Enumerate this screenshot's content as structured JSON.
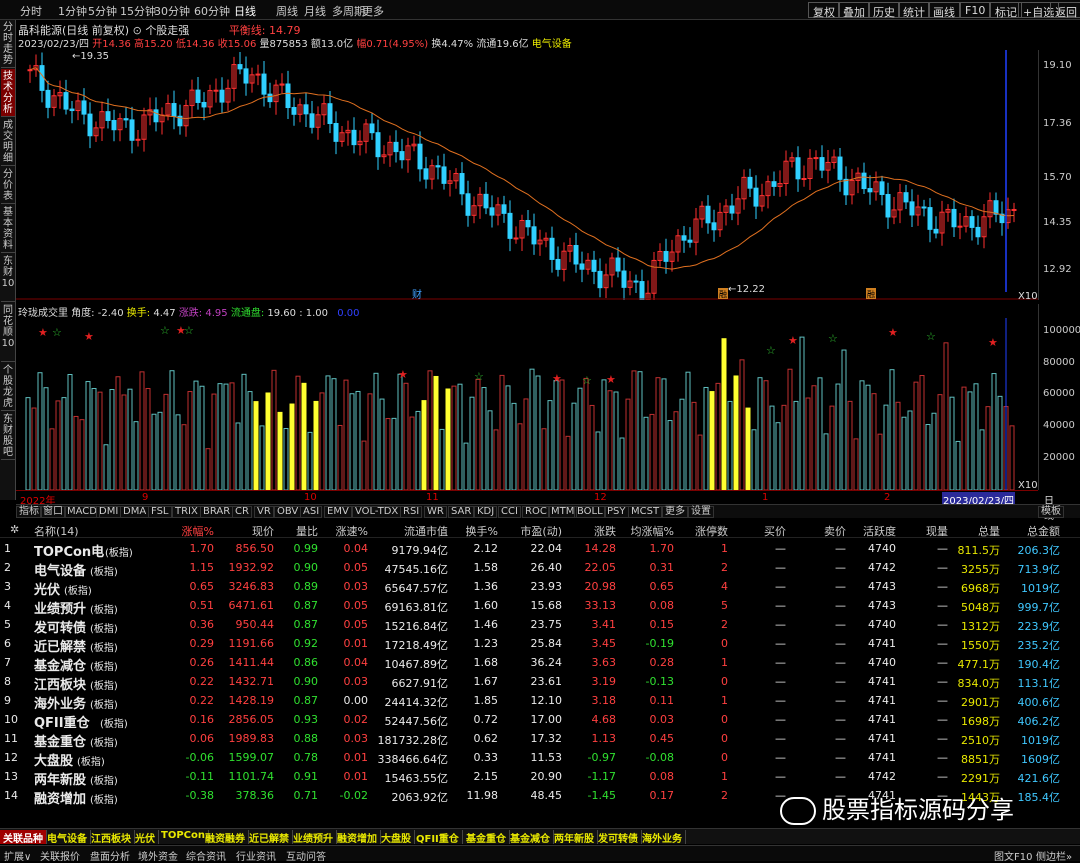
{
  "topbar": {
    "left_items": [
      "分时",
      "1分钟",
      "5分钟",
      "15分钟",
      "30分钟",
      "60分钟",
      "日线",
      "周线",
      "月线",
      "多周期",
      "更多"
    ],
    "active": "日线",
    "right_items": [
      "复权",
      "叠加",
      "历史",
      "统计",
      "画线",
      "F10",
      "标记",
      "+自选",
      "返回"
    ]
  },
  "left_tabs": [
    {
      "label": "分时走势",
      "active": false
    },
    {
      "label": "技术分析",
      "active": true
    },
    {
      "label": "成交明细",
      "active": false
    },
    {
      "label": "分价表",
      "active": false
    },
    {
      "label": "基本资料",
      "active": false
    },
    {
      "label": "东财10",
      "active": false
    },
    {
      "label": "同花顺10",
      "active": false
    },
    {
      "label": "个股龙虎",
      "active": false
    },
    {
      "label": "东财股吧",
      "active": false
    }
  ],
  "chart_header": {
    "title": "晶科能源(日线 前复权)",
    "mode": "个股走强",
    "balance_label": "平衡线: 14.79",
    "date": "2023/02/23/四",
    "open": "开14.36",
    "high": "高15.20",
    "low": "低14.36",
    "close": "收15.06",
    "volume": "量875853",
    "amount": "额13.0亿",
    "change": "幅0.71(4.95%)",
    "turnover": "换4.47%",
    "float_cap": "流通19.6亿",
    "sector": "电气设备"
  },
  "price_chart": {
    "ticks": [
      "19.10",
      "17.36",
      "15.70",
      "14.35",
      "12.92"
    ],
    "marker_high": "19.35",
    "marker_low": "12.22",
    "label_cai": "财",
    "label_hui": "融",
    "label_hui2": "融",
    "zoom": "X10"
  },
  "vol_header": {
    "name": "玲珑成交里",
    "angle": "角度: -2.40",
    "turnover_label": "换手:",
    "turnover": "4.47",
    "rise_label": "涨跌:",
    "rise": "4.95",
    "float_label": "流通盘:",
    "float": "19.60 : 1.00",
    "extra": "0.00"
  },
  "vol_chart": {
    "ticks": [
      "100000",
      "80000",
      "60000",
      "40000",
      "20000"
    ],
    "zoom": "X10"
  },
  "x_axis": {
    "labels": [
      "2022年",
      "9",
      "10",
      "11",
      "12",
      "1",
      "2"
    ],
    "current_date": "2023/02/23/四",
    "period": "日线"
  },
  "indicator_tabs": [
    "指标",
    "窗口",
    "MACD",
    "DMI",
    "DMA",
    "FSL",
    "TRIX",
    "BRAR",
    "CR",
    "VR",
    "OBV",
    "ASI",
    "EMV",
    "VOL-TDX",
    "RSI",
    "WR",
    "SAR",
    "KDJ",
    "CCI",
    "ROC",
    "MTM",
    "BOLL",
    "PSY",
    "MCST",
    "更多",
    "设置"
  ],
  "indicator_right": "模板",
  "table": {
    "headers": [
      "名称(14)",
      "涨幅%",
      "现价",
      "量比",
      "涨速%",
      "流通市值",
      "换手%",
      "市盈(动)",
      "涨跌",
      "均涨幅%",
      "涨停数",
      "买价",
      "卖价",
      "活跃度",
      "现量",
      "总量",
      "总金额"
    ],
    "rows": [
      {
        "no": "1",
        "name": "TOPCon电",
        "tag": "(板指)",
        "chg": "1.70",
        "price": "856.50",
        "vr": "0.99",
        "spd": "0.04",
        "cap": "9179.94亿",
        "to": "2.12",
        "pe": "22.04",
        "diff": "14.28",
        "avg": "1.70",
        "lim": "1",
        "buy": "—",
        "sell": "—",
        "act": "4740",
        "cur": "—",
        "vol": "811.5万",
        "amt": "206.3亿"
      },
      {
        "no": "2",
        "name": "电气设备",
        "tag": "(板指)",
        "chg": "1.15",
        "price": "1932.92",
        "vr": "0.90",
        "spd": "0.05",
        "cap": "47545.16亿",
        "to": "1.58",
        "pe": "26.40",
        "diff": "22.05",
        "avg": "0.31",
        "lim": "2",
        "buy": "—",
        "sell": "—",
        "act": "4742",
        "cur": "—",
        "vol": "3255万",
        "amt": "713.9亿"
      },
      {
        "no": "3",
        "name": "光伏",
        "tag": "(板指)",
        "chg": "0.65",
        "price": "3246.83",
        "vr": "0.89",
        "spd": "0.03",
        "cap": "65647.57亿",
        "to": "1.36",
        "pe": "23.93",
        "diff": "20.98",
        "avg": "0.65",
        "lim": "4",
        "buy": "—",
        "sell": "—",
        "act": "4743",
        "cur": "—",
        "vol": "6968万",
        "amt": "1019亿"
      },
      {
        "no": "4",
        "name": "业绩预升",
        "tag": "(板指)",
        "chg": "0.51",
        "price": "6471.61",
        "vr": "0.87",
        "spd": "0.05",
        "cap": "69163.81亿",
        "to": "1.60",
        "pe": "15.68",
        "diff": "33.13",
        "avg": "0.08",
        "lim": "5",
        "buy": "—",
        "sell": "—",
        "act": "4743",
        "cur": "—",
        "vol": "5048万",
        "amt": "999.7亿"
      },
      {
        "no": "5",
        "name": "发可转债",
        "tag": "(板指)",
        "chg": "0.36",
        "price": "950.44",
        "vr": "0.87",
        "spd": "0.05",
        "cap": "15216.84亿",
        "to": "1.46",
        "pe": "23.75",
        "diff": "3.41",
        "avg": "0.15",
        "lim": "2",
        "buy": "—",
        "sell": "—",
        "act": "4740",
        "cur": "—",
        "vol": "1312万",
        "amt": "223.9亿"
      },
      {
        "no": "6",
        "name": "近已解禁",
        "tag": "(板指)",
        "chg": "0.29",
        "price": "1191.66",
        "vr": "0.92",
        "spd": "0.01",
        "cap": "17218.49亿",
        "to": "1.23",
        "pe": "25.84",
        "diff": "3.45",
        "avg": "-0.19",
        "lim": "0",
        "buy": "—",
        "sell": "—",
        "act": "4741",
        "cur": "—",
        "vol": "1550万",
        "amt": "235.2亿"
      },
      {
        "no": "7",
        "name": "基金减仓",
        "tag": "(板指)",
        "chg": "0.26",
        "price": "1411.44",
        "vr": "0.86",
        "spd": "0.04",
        "cap": "10467.89亿",
        "to": "1.68",
        "pe": "36.24",
        "diff": "3.63",
        "avg": "0.28",
        "lim": "1",
        "buy": "—",
        "sell": "—",
        "act": "4740",
        "cur": "—",
        "vol": "477.1万",
        "amt": "190.4亿"
      },
      {
        "no": "8",
        "name": "江西板块",
        "tag": "(板指)",
        "chg": "0.22",
        "price": "1432.71",
        "vr": "0.90",
        "spd": "0.03",
        "cap": "6627.91亿",
        "to": "1.67",
        "pe": "23.61",
        "diff": "3.19",
        "avg": "-0.13",
        "lim": "0",
        "buy": "—",
        "sell": "—",
        "act": "4741",
        "cur": "—",
        "vol": "834.0万",
        "amt": "113.1亿"
      },
      {
        "no": "9",
        "name": "海外业务",
        "tag": "(板指)",
        "chg": "0.22",
        "price": "1428.19",
        "vr": "0.87",
        "spd": "0.00",
        "cap": "24414.32亿",
        "to": "1.85",
        "pe": "12.10",
        "diff": "3.18",
        "avg": "0.11",
        "lim": "1",
        "buy": "—",
        "sell": "—",
        "act": "4741",
        "cur": "—",
        "vol": "2901万",
        "amt": "400.6亿"
      },
      {
        "no": "10",
        "name": "QFII重仓",
        "tag": "(板指)",
        "chg": "0.16",
        "price": "2856.05",
        "vr": "0.93",
        "spd": "0.02",
        "cap": "52447.56亿",
        "to": "0.72",
        "pe": "17.00",
        "diff": "4.68",
        "avg": "0.03",
        "lim": "0",
        "buy": "—",
        "sell": "—",
        "act": "4741",
        "cur": "—",
        "vol": "1698万",
        "amt": "406.2亿"
      },
      {
        "no": "11",
        "name": "基金重仓",
        "tag": "(板指)",
        "chg": "0.06",
        "price": "1989.83",
        "vr": "0.88",
        "spd": "0.03",
        "cap": "181732.28亿",
        "to": "0.62",
        "pe": "17.32",
        "diff": "1.13",
        "avg": "0.45",
        "lim": "0",
        "buy": "—",
        "sell": "—",
        "act": "4741",
        "cur": "—",
        "vol": "2510万",
        "amt": "1019亿"
      },
      {
        "no": "12",
        "name": "大盘股",
        "tag": "(板指)",
        "chg": "-0.06",
        "price": "1599.07",
        "vr": "0.78",
        "spd": "0.01",
        "cap": "338466.64亿",
        "to": "0.33",
        "pe": "11.53",
        "diff": "-0.97",
        "avg": "-0.08",
        "lim": "0",
        "buy": "—",
        "sell": "—",
        "act": "4741",
        "cur": "—",
        "vol": "8851万",
        "amt": "1609亿"
      },
      {
        "no": "13",
        "name": "两年新股",
        "tag": "(板指)",
        "chg": "-0.11",
        "price": "1101.74",
        "vr": "0.91",
        "spd": "0.01",
        "cap": "15463.55亿",
        "to": "2.15",
        "pe": "20.90",
        "diff": "-1.17",
        "avg": "0.08",
        "lim": "1",
        "buy": "—",
        "sell": "—",
        "act": "4742",
        "cur": "—",
        "vol": "2291万",
        "amt": "421.6亿"
      },
      {
        "no": "14",
        "name": "融资增加",
        "tag": "(板指)",
        "chg": "-0.38",
        "price": "378.36",
        "vr": "0.71",
        "spd": "-0.02",
        "cap": "2063.92亿",
        "to": "11.98",
        "pe": "48.45",
        "diff": "-1.45",
        "avg": "0.17",
        "lim": "2",
        "buy": "—",
        "sell": "—",
        "act": "4741",
        "cur": "—",
        "vol": "1443万",
        "amt": "185.4亿"
      }
    ]
  },
  "block_tabs": [
    "关联品种",
    "电气设备",
    "江西板块",
    "光伏",
    "TOPCon",
    "融资融券",
    "近已解禁",
    "业绩预升",
    "融资增加",
    "大盘股",
    "QFII重仓",
    "基金重仓",
    "基金减仓",
    "两年新股",
    "发可转债",
    "海外业务"
  ],
  "status_tabs": [
    "扩展∨",
    "关联报价",
    "盘面分析",
    "境外资金",
    "综合资讯",
    "行业资讯",
    "互动问答"
  ],
  "status_right": [
    "图文F10",
    "侧边栏»"
  ],
  "watermark": "股票指标源码分享",
  "colors": {
    "up": "#ff3030",
    "down": "#30d0ff",
    "ma": "#e07020",
    "highlight": "#ffff30",
    "vol_up": "#c03030",
    "vol_down": "#60c0c0"
  }
}
